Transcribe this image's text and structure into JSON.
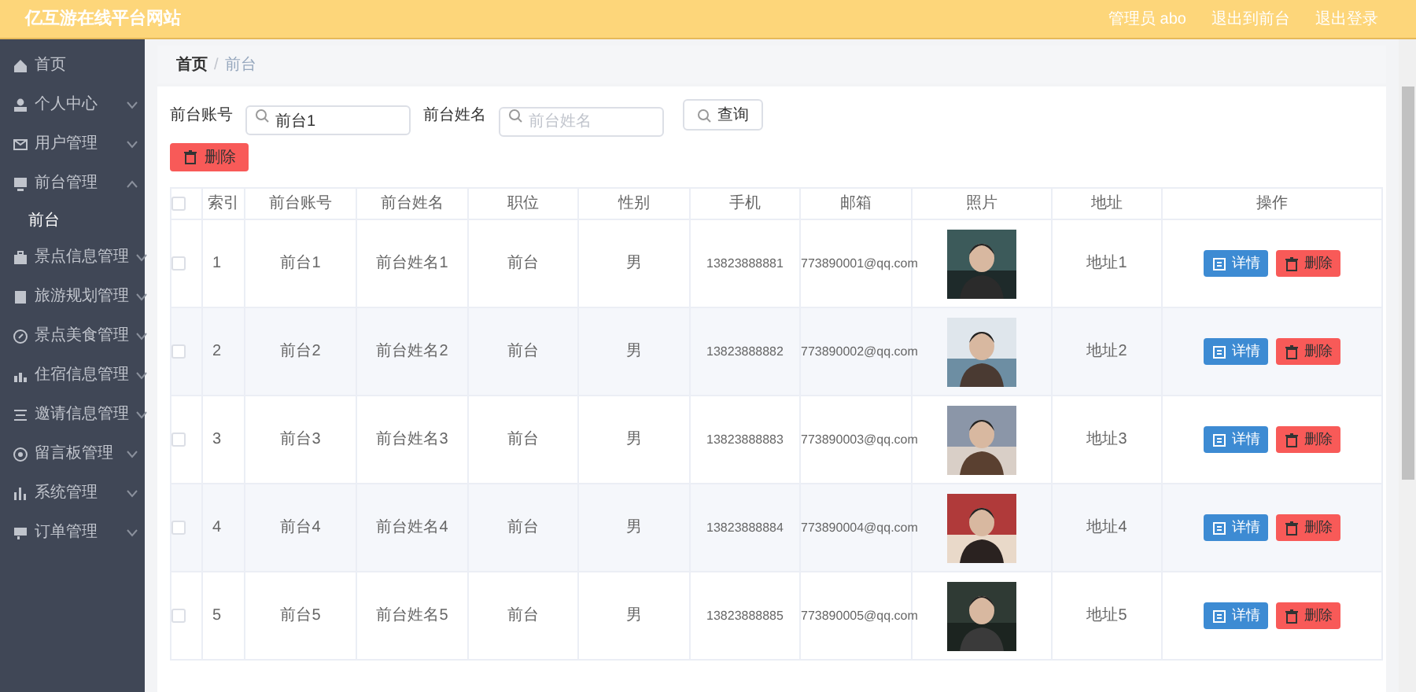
{
  "header": {
    "title": "亿互游在线平台网站",
    "links": [
      "管理员 abo",
      "退出到前台",
      "退出登录"
    ]
  },
  "sidebar": {
    "items": [
      {
        "label": "首页",
        "selected": false
      },
      {
        "label": "个人中心",
        "selected": false,
        "expanded": false
      },
      {
        "label": "用户管理",
        "selected": false,
        "expanded": false
      },
      {
        "label": "前台管理",
        "selected": false,
        "expanded": true,
        "children": [
          {
            "label": "前台",
            "selected": true
          }
        ]
      },
      {
        "label": "景点信息管理",
        "selected": false,
        "expanded": false
      },
      {
        "label": "旅游规划管理",
        "selected": false,
        "expanded": false
      },
      {
        "label": "景点美食管理",
        "selected": false,
        "expanded": false
      },
      {
        "label": "住宿信息管理",
        "selected": false,
        "expanded": false
      },
      {
        "label": "邀请信息管理",
        "selected": false,
        "expanded": false
      },
      {
        "label": "留言板管理",
        "selected": false,
        "expanded": false
      },
      {
        "label": "系统管理",
        "selected": false,
        "expanded": false
      },
      {
        "label": "订单管理",
        "selected": false,
        "expanded": false
      }
    ]
  },
  "breadcrumb": [
    "首页",
    "/",
    "前台"
  ],
  "filters": [
    {
      "label": "前台账号",
      "value": "前台1"
    },
    {
      "label": "前台姓名",
      "placeholder": "前台姓名"
    }
  ],
  "search_button": "查询",
  "delete_button": "删除",
  "table": {
    "all_checked": false,
    "columns": [
      "索引",
      "前台账号",
      "前台姓名",
      "职位",
      "性别",
      "手机",
      "邮箱",
      "照片",
      "地址",
      "操作"
    ],
    "rows": [
      {
        "checked": false,
        "cells": [
          "1",
          "前台1",
          "前台姓名1",
          "前台",
          "男",
          "13823888881",
          "773890001@qq.com",
          "地址1"
        ],
        "actions": [
          "详情",
          "删除"
        ]
      },
      {
        "checked": false,
        "cells": [
          "2",
          "前台2",
          "前台姓名2",
          "前台",
          "男",
          "13823888882",
          "773890002@qq.com",
          "地址2"
        ],
        "actions": [
          "详情",
          "删除"
        ]
      },
      {
        "checked": false,
        "cells": [
          "3",
          "前台3",
          "前台姓名3",
          "前台",
          "男",
          "13823888883",
          "773890003@qq.com",
          "地址3"
        ],
        "actions": [
          "详情",
          "删除"
        ]
      },
      {
        "checked": false,
        "cells": [
          "4",
          "前台4",
          "前台姓名4",
          "前台",
          "男",
          "13823888884",
          "773890004@qq.com",
          "地址4"
        ],
        "actions": [
          "详情",
          "删除"
        ]
      },
      {
        "checked": false,
        "cells": [
          "5",
          "前台5",
          "前台姓名5",
          "前台",
          "男",
          "13823888885",
          "773890005@qq.com",
          "地址5"
        ],
        "actions": [
          "详情",
          "删除"
        ]
      }
    ]
  }
}
